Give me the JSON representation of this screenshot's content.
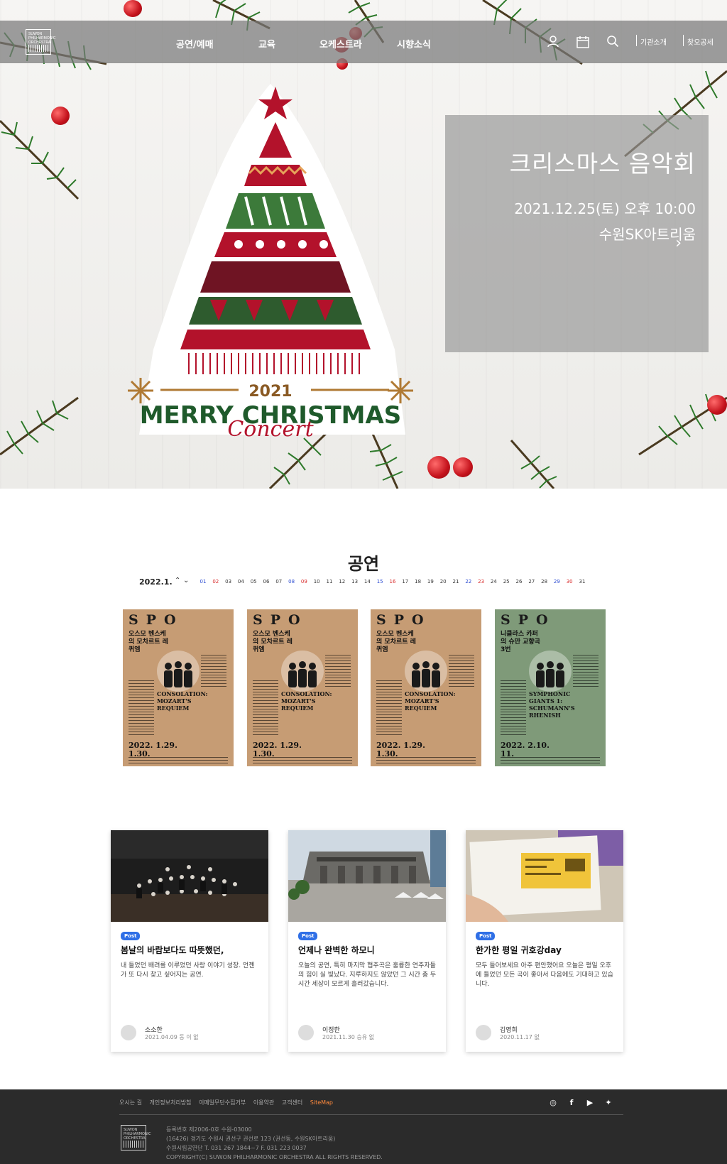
{
  "header": {
    "logo_text": "SUWON PHILHARMONIC ORCHESTRA",
    "nav": [
      "공연/예매",
      "교육",
      "오케스트라",
      "시향소식"
    ],
    "links": [
      "기관소개",
      "찾오공세"
    ]
  },
  "hero": {
    "title": "크리스마스 음악회",
    "date": "2021.12.25(토) 오후 10:00",
    "venue": "수원SK아트리움",
    "poster_year": "2021",
    "poster_line1": "MERRY CHRISTMAS",
    "poster_line2": "Concert"
  },
  "performances": {
    "section_title": "공연",
    "month": "2022.1.",
    "days": [
      "01",
      "02",
      "03",
      "04",
      "05",
      "06",
      "07",
      "08",
      "09",
      "10",
      "11",
      "12",
      "13",
      "14",
      "15",
      "16",
      "17",
      "18",
      "19",
      "20",
      "21",
      "22",
      "23",
      "24",
      "25",
      "26",
      "27",
      "28",
      "29",
      "30",
      "31"
    ],
    "cards": [
      {
        "brand": "SPO",
        "ko_title": "오스모 벤스케의 모차르트 레퀴엠",
        "en_title": "CONSOLATION: MOZART'S REQUIEM",
        "date": "2022. 1.29. 1.30.",
        "bg": "#c69c74"
      },
      {
        "brand": "SPO",
        "ko_title": "오스모 벤스케의 모차르트 레퀴엠",
        "en_title": "CONSOLATION: MOZART'S REQUIEM",
        "date": "2022. 1.29. 1.30.",
        "bg": "#c69c74"
      },
      {
        "brand": "SPO",
        "ko_title": "오스모 벤스케의 모차르트 레퀴엠",
        "en_title": "CONSOLATION: MOZART'S REQUIEM",
        "date": "2022. 1.29. 1.30.",
        "bg": "#c69c74"
      },
      {
        "brand": "SPO",
        "ko_title": "니클라스 카퍼의 슈만 교향곡 3번",
        "en_title": "SYMPHONIC GIANTS 1: SCHUMANN'S RHENISH",
        "date": "2022. 2.10. 11.",
        "bg": "#7f9a79"
      }
    ]
  },
  "posts": [
    {
      "badge": "Post",
      "title": "봄날의 바람보다도 따뜻했던,",
      "excerpt": "내 들었던 배려를 이루었던 사랑 이야기 성장. 언젠가 또 다시 찾고 싶어지는 공연.",
      "author": "소소한",
      "date": "2021.04.09 동 이 없"
    },
    {
      "badge": "Post",
      "title": "언제나 완벽한 하모니",
      "excerpt": "오늘의 공연, 특히 마지막 협주곡은 훌륭한 연주자들의 힘이 실 빛났다. 지루하지도 않았던 그 시간 총 두 시간 세상이 모르게 흘러갔습니다.",
      "author": "이정한",
      "date": "2021.11.30 승유 없"
    },
    {
      "badge": "Post",
      "title": "한가한 평일 귀호강day",
      "excerpt": "모두 들어보세요 아주 편안했어요 오늘은 평일 오후에 들었던 모든 곡이 좋아서 다음에도 기대하고 있습니다.",
      "author": "김영희",
      "date": "2020.11.17 없"
    }
  ],
  "footer": {
    "links": [
      "오시는 길",
      "개인정보처리방침",
      "이메일무단수집거부",
      "이용약관",
      "고객센터",
      "SiteMap"
    ],
    "info": [
      "등록번호 제2006-0호 수원-03000",
      "(16426) 경기도 수원시 권선구 권선로 123 (권선동, 수원SK아트리움)",
      "수원시립공연단 T. 031 267 1844~7  F. 031 223 0037",
      "COPYRIGHT(C) SUWON PHILHARMONIC ORCHESTRA ALL RIGHTS RESERVED."
    ],
    "social": [
      "instagram-icon",
      "facebook-icon",
      "youtube-icon",
      "twitter-icon"
    ]
  },
  "colors": {
    "accent_blue": "#2f6fe6",
    "footer_bg": "#2b2b2b",
    "sitemap": "#ff8a3d",
    "poster_tan": "#c69c74",
    "poster_green": "#7f9a79"
  }
}
